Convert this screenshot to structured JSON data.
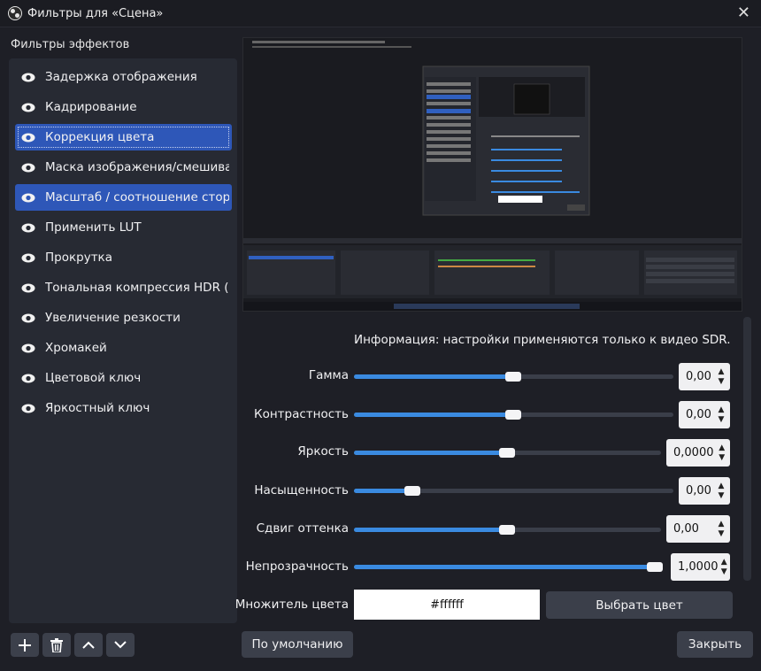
{
  "window": {
    "title": "Фильтры для «Сцена»",
    "close_glyph": "✕"
  },
  "filters": {
    "section_label": "Фильтры эффектов",
    "items": [
      {
        "label": "Задержка отображения",
        "icon": "eye-icon"
      },
      {
        "label": "Кадрирование",
        "icon": "eye-icon"
      },
      {
        "label": "Коррекция цвета",
        "icon": "eye-icon",
        "selected": true
      },
      {
        "label": "Маска изображения/смешивани",
        "icon": "eye-icon"
      },
      {
        "label": "Масштаб / соотношение сторон",
        "icon": "eye-icon",
        "selected": true
      },
      {
        "label": "Применить LUT",
        "icon": "eye-icon"
      },
      {
        "label": "Прокрутка",
        "icon": "eye-icon"
      },
      {
        "label": "Тональная компрессия HDR (под",
        "icon": "eye-icon"
      },
      {
        "label": "Увеличение резкости",
        "icon": "eye-icon"
      },
      {
        "label": "Хромакей",
        "icon": "eye-icon"
      },
      {
        "label": "Цветовой ключ",
        "icon": "eye-icon"
      },
      {
        "label": "Яркостный ключ",
        "icon": "eye-icon"
      }
    ],
    "toolbar": [
      "plus-icon",
      "trash-icon",
      "chevron-up-icon",
      "chevron-down-icon"
    ]
  },
  "settings": {
    "info": "Информация: настройки применяются только к видео SDR.",
    "gamma": {
      "label": "Гамма",
      "value": "0,00",
      "level": 0.5
    },
    "contrast": {
      "label": "Контрастность",
      "value": "0,00",
      "level": 0.5
    },
    "brightness": {
      "label": "Яркость",
      "value": "0,0000",
      "level": 0.5
    },
    "saturation": {
      "label": "Насыщенность",
      "value": "0,00",
      "level": 0.18
    },
    "hue": {
      "label": "Сдвиг оттенка",
      "value": "0,00",
      "level": 0.5
    },
    "opacity": {
      "label": "Непрозрачность",
      "value": "1,0000",
      "level": 1.0
    },
    "color_multiplier": {
      "label": "Множитель цвета",
      "value": "#ffffff",
      "button": "Выбрать цвет"
    }
  },
  "footer": {
    "defaults_button": "По умолчанию",
    "close_button": "Закрыть"
  },
  "colors": {
    "accent": "#2e57b8",
    "slider_fill": "#3a8ae0",
    "background": "#1e1f26"
  }
}
